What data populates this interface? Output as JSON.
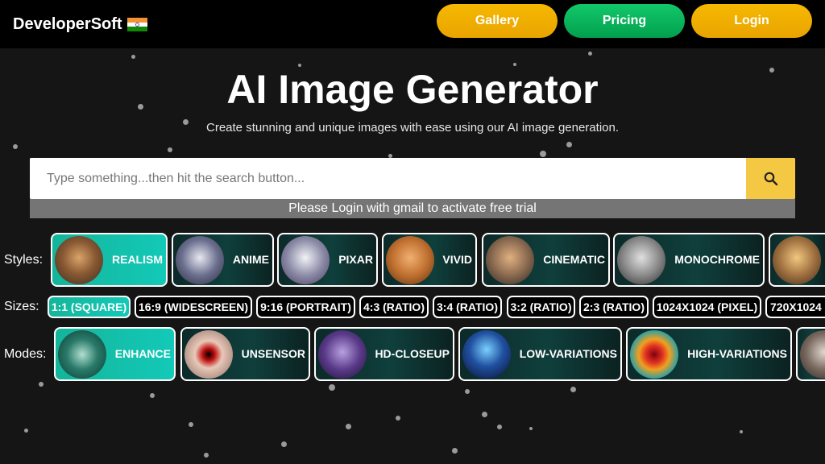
{
  "header": {
    "brand": "DeveloperSoft",
    "nav": [
      {
        "label": "Gallery"
      },
      {
        "label": "Pricing"
      },
      {
        "label": "Login"
      }
    ]
  },
  "hero": {
    "title": "AI Image Generator",
    "subtitle": "Create stunning and unique images with ease using our AI image generation."
  },
  "search": {
    "placeholder": "Type something...then hit the search button...",
    "value": ""
  },
  "notice": "Please Login with gmail to activate free trial",
  "styles": {
    "label": "Styles:",
    "items": [
      {
        "label": "REALISM",
        "active": true
      },
      {
        "label": "ANIME",
        "active": false
      },
      {
        "label": "PIXAR",
        "active": false
      },
      {
        "label": "VIVID",
        "active": false
      },
      {
        "label": "CINEMATIC",
        "active": false
      },
      {
        "label": "MONOCHROME",
        "active": false
      },
      {
        "label": "",
        "active": false
      }
    ]
  },
  "sizes": {
    "label": "Sizes:",
    "items": [
      {
        "label": "1:1 (SQUARE)",
        "active": true
      },
      {
        "label": "16:9 (WIDESCREEN)",
        "active": false
      },
      {
        "label": "9:16 (PORTRAIT)",
        "active": false
      },
      {
        "label": "4:3 (RATIO)",
        "active": false
      },
      {
        "label": "3:4 (RATIO)",
        "active": false
      },
      {
        "label": "3:2 (RATIO)",
        "active": false
      },
      {
        "label": "2:3 (RATIO)",
        "active": false
      },
      {
        "label": "1024X1024 (PIXEL)",
        "active": false
      },
      {
        "label": "720X1024 (",
        "active": false
      }
    ]
  },
  "modes": {
    "label": "Modes:",
    "items": [
      {
        "label": "ENHANCE",
        "active": true
      },
      {
        "label": "UNSENSOR",
        "active": false
      },
      {
        "label": "HD-CLOSEUP",
        "active": false
      },
      {
        "label": "LOW-VARIATIONS",
        "active": false
      },
      {
        "label": "HIGH-VARIATIONS",
        "active": false
      },
      {
        "label": "",
        "active": false
      }
    ]
  },
  "colors": {
    "accent_yellow": "#f5c843",
    "accent_green": "#02a04e",
    "active_teal": "#13c9b8"
  }
}
